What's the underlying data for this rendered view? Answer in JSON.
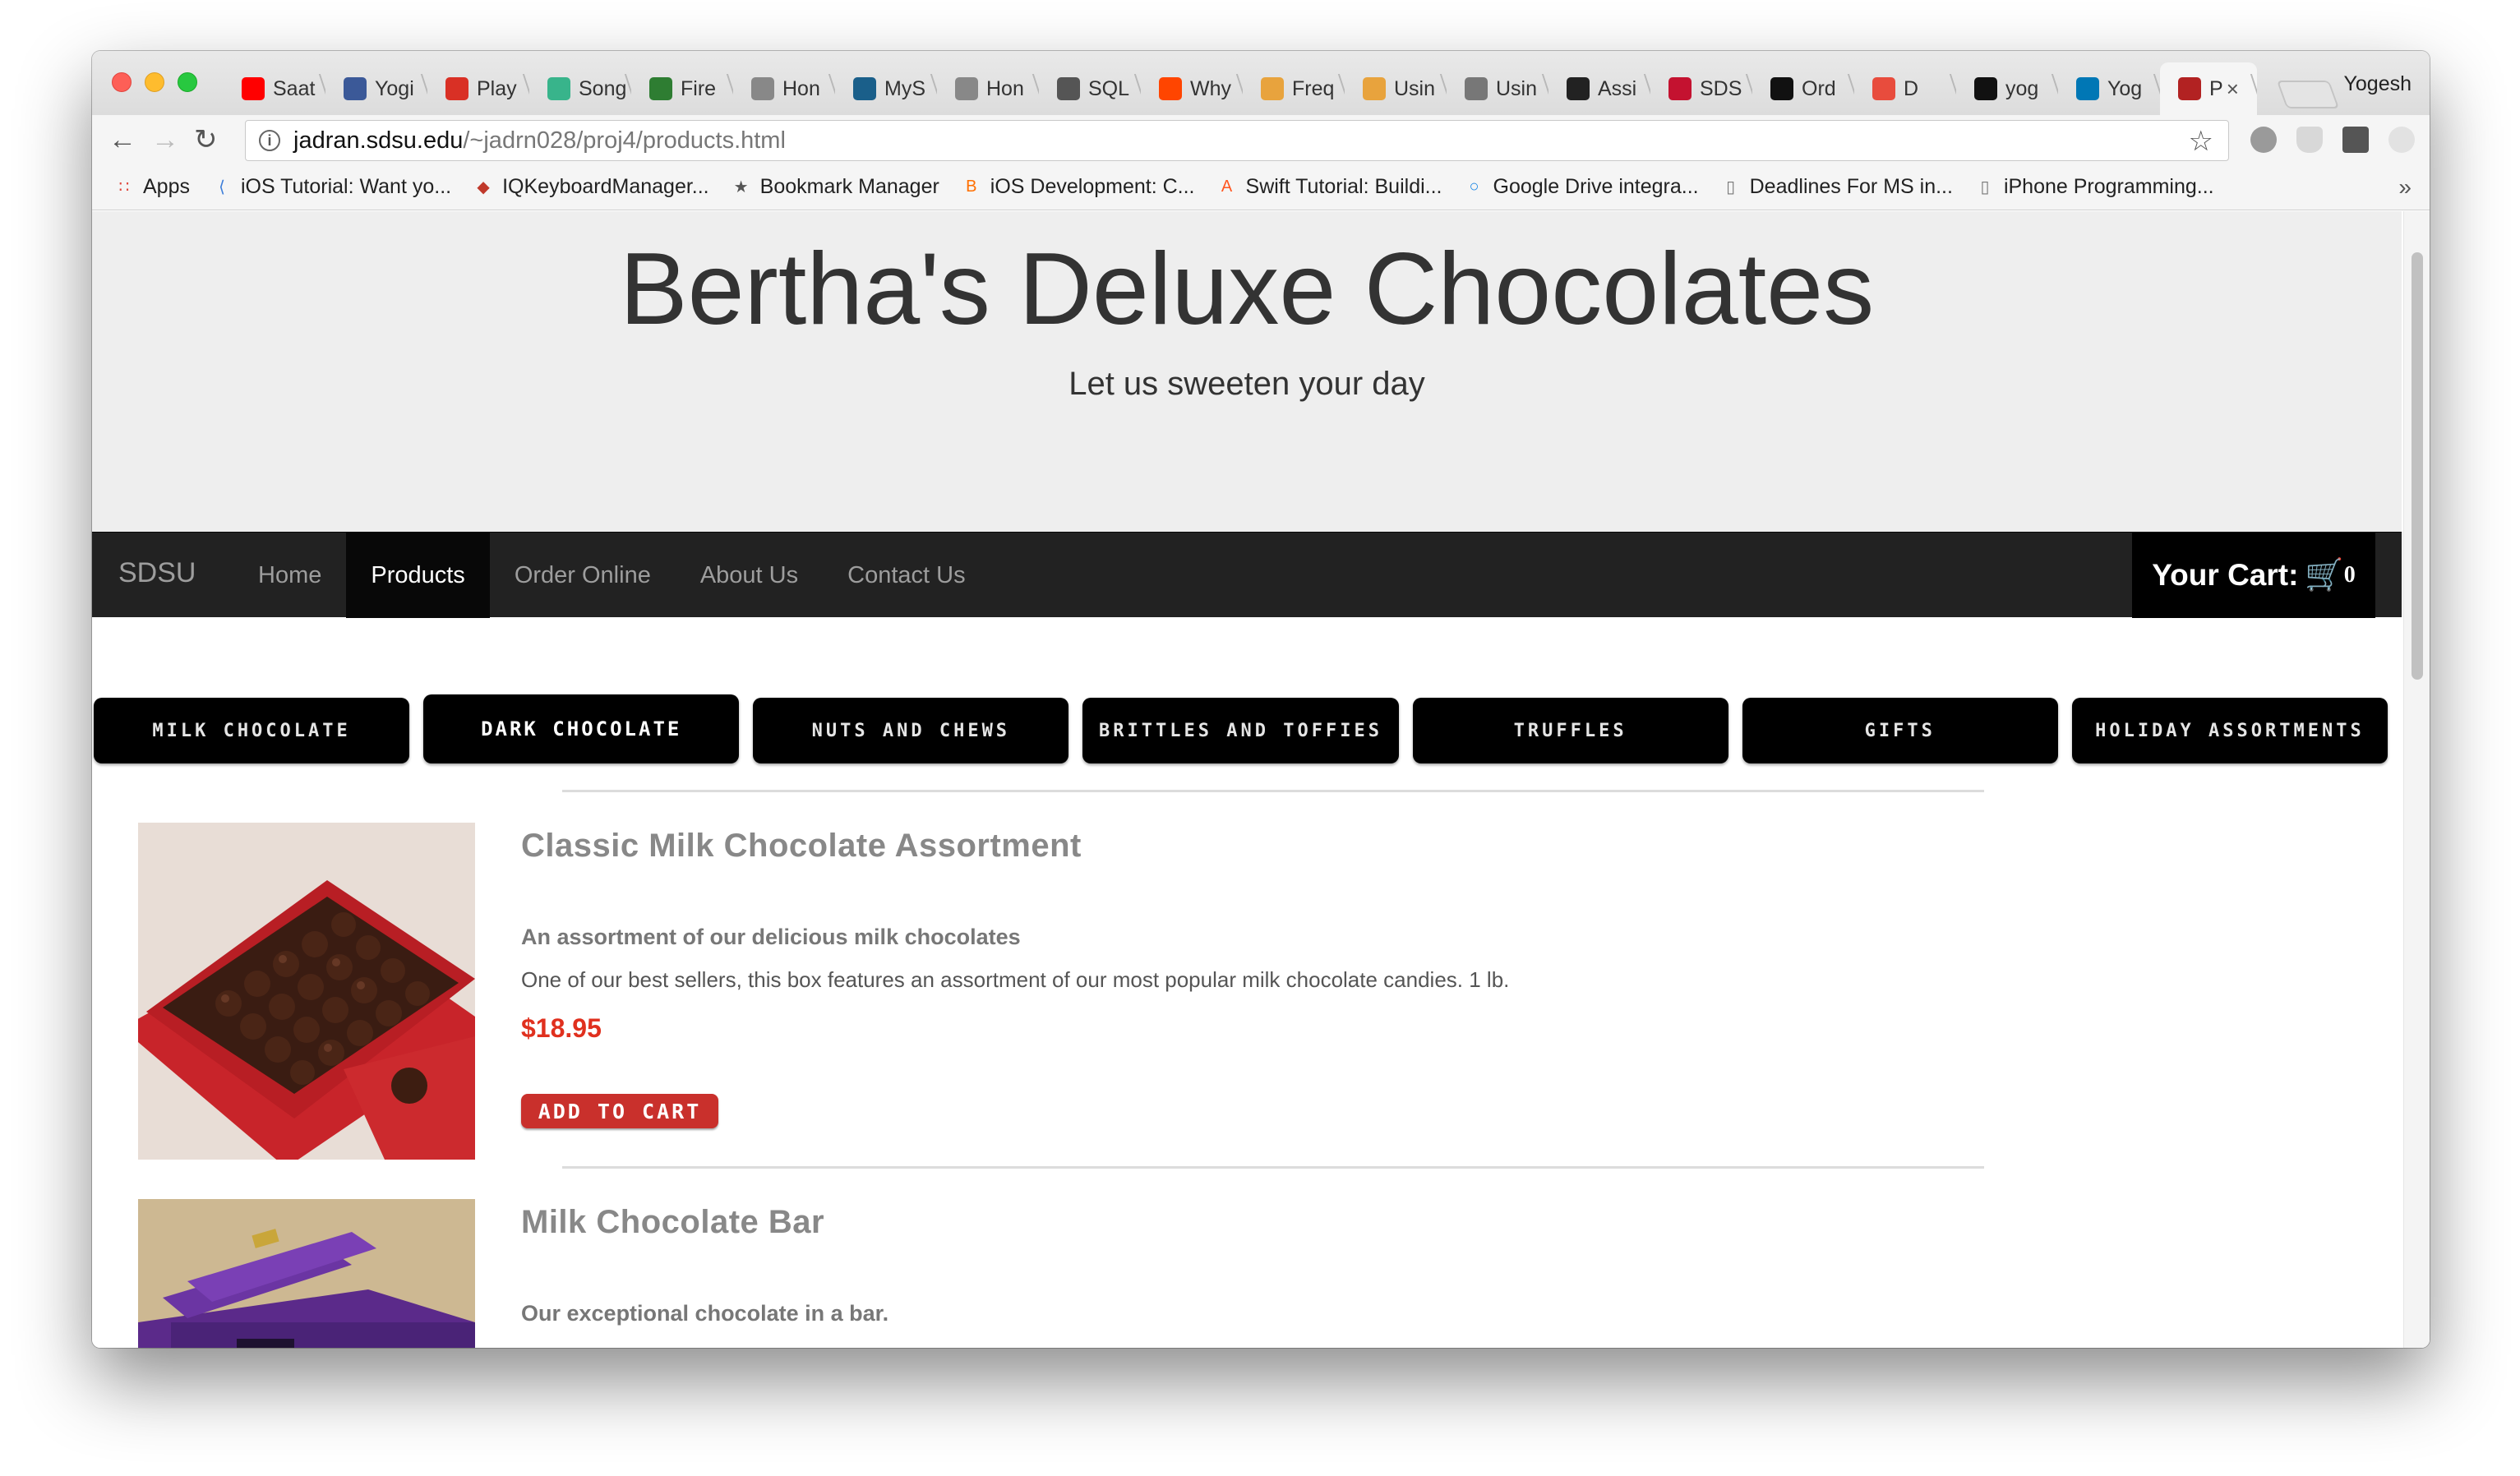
{
  "browser": {
    "tabs": [
      {
        "title": "Saat",
        "icon": "youtube-icon",
        "color": "#ff0000"
      },
      {
        "title": "Yogi",
        "icon": "facebook-icon",
        "color": "#3b5998"
      },
      {
        "title": "Play",
        "icon": "gmail-icon",
        "color": "#d93025"
      },
      {
        "title": "Song",
        "icon": "music-icon",
        "color": "#38b48b"
      },
      {
        "title": "Fire",
        "icon": "firebase-icon",
        "color": "#2e7d32"
      },
      {
        "title": "Hon",
        "icon": "settings-icon",
        "color": "#888888"
      },
      {
        "title": "MyS",
        "icon": "mysql-icon",
        "color": "#1a5f8a"
      },
      {
        "title": "Hon",
        "icon": "settings-icon",
        "color": "#888888"
      },
      {
        "title": "SQL",
        "icon": "layers-icon",
        "color": "#555555"
      },
      {
        "title": "Why",
        "icon": "reddit-icon",
        "color": "#ff4500"
      },
      {
        "title": "Freq",
        "icon": "chrome-icon",
        "color": "#e8a33d"
      },
      {
        "title": "Usin",
        "icon": "chrome-icon",
        "color": "#e8a33d"
      },
      {
        "title": "Usin",
        "icon": "document-icon",
        "color": "#777777"
      },
      {
        "title": "Assi",
        "icon": "bb-icon",
        "color": "#222222"
      },
      {
        "title": "SDS",
        "icon": "sdsu-icon",
        "color": "#c41230"
      },
      {
        "title": "Ord",
        "icon": "github-icon",
        "color": "#111111"
      },
      {
        "title": "D",
        "icon": "g-icon",
        "color": "#e84c3d"
      },
      {
        "title": "yog",
        "icon": "github-icon",
        "color": "#111111"
      },
      {
        "title": "Yog",
        "icon": "linkedin-icon",
        "color": "#0077b5"
      },
      {
        "title": "P",
        "icon": "page-icon",
        "color": "#b22222",
        "active": true
      }
    ],
    "profile_name": "Yogesh",
    "url_host": "jadran.sdsu.edu",
    "url_path": "/~jadrn028/proj4/products.html",
    "bookmarks": [
      {
        "label": "Apps",
        "icon": "apps-grid-icon"
      },
      {
        "label": "iOS Tutorial: Want yo...",
        "icon": "swift-icon"
      },
      {
        "label": "IQKeyboardManager...",
        "icon": "keyboard-icon"
      },
      {
        "label": "Bookmark Manager",
        "icon": "star-icon"
      },
      {
        "label": "iOS Development: C...",
        "icon": "blogger-icon"
      },
      {
        "label": "Swift Tutorial: Buildi...",
        "icon": "a-icon"
      },
      {
        "label": "Google Drive integra...",
        "icon": "drive-icon"
      },
      {
        "label": "Deadlines For MS in...",
        "icon": "document-icon"
      },
      {
        "label": "iPhone Programming...",
        "icon": "document-icon"
      }
    ]
  },
  "page": {
    "title": "Bertha's Deluxe Chocolates",
    "tagline": "Let us sweeten your day",
    "nav": {
      "brand": "SDSU",
      "links": [
        {
          "label": "Home",
          "active": false
        },
        {
          "label": "Products",
          "active": true
        },
        {
          "label": "Order Online",
          "active": false
        },
        {
          "label": "About Us",
          "active": false
        },
        {
          "label": "Contact Us",
          "active": false
        }
      ],
      "cart_label": "Your Cart:",
      "cart_count": "0"
    },
    "categories": [
      {
        "label": "MILK CHOCOLATE",
        "active": false
      },
      {
        "label": "DARK CHOCOLATE",
        "active": true
      },
      {
        "label": "NUTS AND CHEWS",
        "active": false
      },
      {
        "label": "BRITTLES AND TOFFIES",
        "active": false
      },
      {
        "label": "TRUFFLES",
        "active": false
      },
      {
        "label": "GIFTS",
        "active": false
      },
      {
        "label": "HOLIDAY ASSORTMENTS",
        "active": false
      }
    ],
    "products": [
      {
        "name": "Classic Milk Chocolate Assortment",
        "short_desc": "An assortment of our delicious milk chocolates",
        "long_desc": "One of our best sellers, this box features an assortment of our most popular milk chocolate candies. 1 lb.",
        "price": "$18.95",
        "button": "ADD TO CART"
      },
      {
        "name": "Milk Chocolate Bar",
        "short_desc": "Our exceptional chocolate in a bar."
      }
    ],
    "colors": {
      "price": "#e0301e",
      "button": "#c9302c",
      "navbar": "#222222",
      "jumbotron": "#eeeeee"
    }
  }
}
